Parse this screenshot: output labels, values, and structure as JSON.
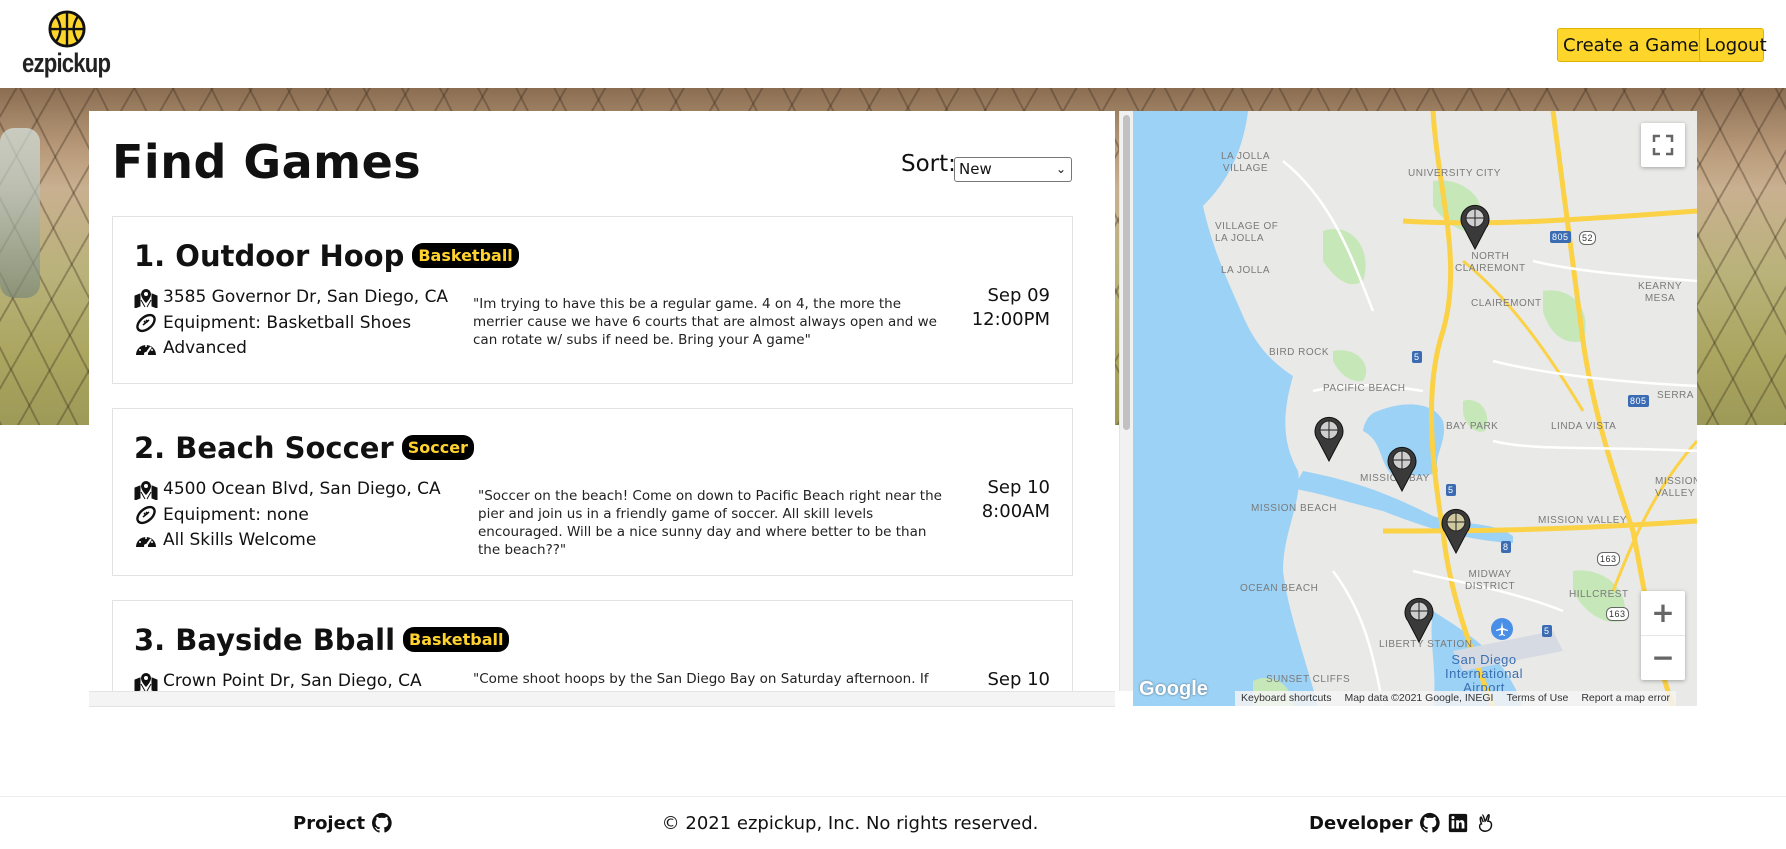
{
  "header": {
    "logo_text": "ezpickup",
    "create_button": "Create a Game",
    "logout_button": "Logout"
  },
  "main": {
    "title": "Find Games",
    "sort": {
      "label": "Sort:",
      "selected": "New"
    }
  },
  "games": [
    {
      "title": "1. Outdoor Hoop",
      "badge": "Basketball",
      "address": "3585 Governor Dr, San Diego, CA",
      "equipment": "Equipment: Basketball Shoes",
      "skill": "Advanced",
      "description": "\"Im trying to have this be a regular game. 4 on 4, the more the merrier cause we have 6 courts that are almost always open and we can rotate w/ subs if need be. Bring your A game\"",
      "date": "Sep 09",
      "time": "12:00PM"
    },
    {
      "title": "2. Beach Soccer",
      "badge": "Soccer",
      "address": "4500 Ocean Blvd, San Diego, CA",
      "equipment": "Equipment: none",
      "skill": "All Skills Welcome",
      "description": "\"Soccer on the beach! Come on down to Pacific Beach right near the pier and join us in a friendly game of soccer. All skill levels encouraged. Will be a nice sunny day and where better to be than the beach??\"",
      "date": "Sep 10",
      "time": "8:00AM"
    },
    {
      "title": "3. Bayside Bball",
      "badge": "Basketball",
      "address": "Crown Point Dr, San Diego, CA",
      "equipment": "",
      "skill": "",
      "description": "\"Come shoot hoops by the San Diego Bay on Saturday afternoon. If you",
      "date": "Sep 10",
      "time": ""
    }
  ],
  "map": {
    "labels": {
      "la_jolla_village": "LA JOLLA\nVILLAGE",
      "university_city": "UNIVERSITY CITY",
      "village_of_la_jolla": "VILLAGE OF\nLA JOLLA",
      "la_jolla": "LA JOLLA",
      "north_clairemont": "NORTH\nCLAIREMONT",
      "clairemont": "CLAIREMONT",
      "kearny_mesa": "KEARNY MESA",
      "bird_rock": "BIRD ROCK",
      "pacific_beach": "PACIFIC BEACH",
      "bay_park": "BAY PARK",
      "linda_vista": "LINDA VISTA",
      "serra": "SERRA",
      "mission_bay": "MISSION BAY",
      "mission_beach": "MISSION BEACH",
      "mission_valley_east": "MISSION\nVALLEY EAS",
      "mission_valley": "MISSION VALLEY",
      "ocean_beach": "OCEAN BEACH",
      "midway_district": "MIDWAY\nDISTRICT",
      "hillcrest": "HILLCREST",
      "liberty_station": "LIBERTY STATION",
      "sunset_cliffs": "SUNSET CLIFFS",
      "airport": "San Diego\nInternational\nAirport"
    },
    "shields": [
      "805",
      "52",
      "5",
      "805",
      "5",
      "8",
      "163",
      "163",
      "5"
    ],
    "google": "Google",
    "footer": [
      "Keyboard shortcuts",
      "Map data ©2021 Google, INEGI",
      "Terms of Use",
      "Report a map error"
    ],
    "zoom_in": "+",
    "zoom_out": "−"
  },
  "footer": {
    "project": "Project",
    "copyright": "© 2021 ezpickup, Inc. No rights reserved.",
    "developer": "Developer"
  },
  "colors": {
    "accent": "#fdd52b",
    "badge_text": "#ffd22e",
    "badge_bg": "#000000",
    "water": "#9cd2f5",
    "park": "#c6e8b8",
    "highway": "#fbd146"
  },
  "icons": [
    "basketball-logo-icon",
    "map-location-icon",
    "football-icon",
    "gauge-icon",
    "map-pin-icon",
    "fullscreen-icon",
    "airport-icon",
    "github-icon",
    "linkedin-icon",
    "angellist-icon"
  ]
}
